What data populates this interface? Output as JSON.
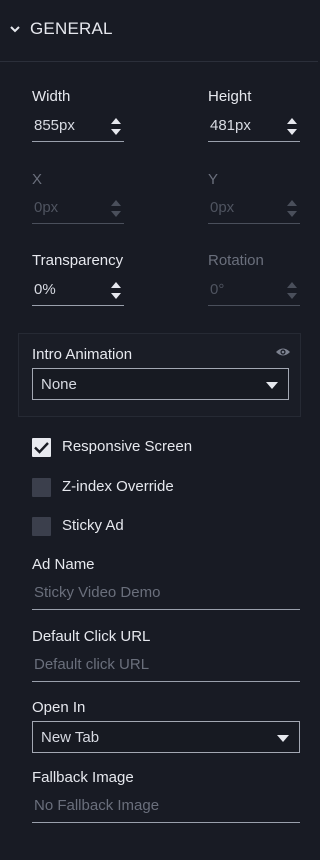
{
  "section": {
    "title": "GENERAL",
    "icon": "chevron-down-icon"
  },
  "fields": {
    "width": {
      "label": "Width",
      "value": "855px"
    },
    "height": {
      "label": "Height",
      "value": "481px"
    },
    "x": {
      "label": "X",
      "placeholder": "0px"
    },
    "y": {
      "label": "Y",
      "placeholder": "0px"
    },
    "transparency": {
      "label": "Transparency",
      "value": "0%"
    },
    "rotation": {
      "label": "Rotation",
      "placeholder": "0°"
    }
  },
  "intro_animation": {
    "label": "Intro Animation",
    "value": "None",
    "icon": "eye-icon"
  },
  "checkboxes": [
    {
      "label": "Responsive Screen",
      "checked": true
    },
    {
      "label": "Z-index Override",
      "checked": false
    },
    {
      "label": "Sticky Ad",
      "checked": false
    }
  ],
  "ad_name": {
    "label": "Ad Name",
    "placeholder": "Sticky Video Demo"
  },
  "default_click_url": {
    "label": "Default Click URL",
    "placeholder": "Default click URL"
  },
  "open_in": {
    "label": "Open In",
    "value": "New Tab"
  },
  "fallback_image": {
    "label": "Fallback Image",
    "placeholder": "No Fallback Image"
  },
  "colors": {
    "background": "#181b24",
    "text": "#e6e8ee",
    "muted": "#6a6f7c",
    "checkbox_on": "#e8eaf0",
    "checkbox_off": "#3b3f4c"
  }
}
